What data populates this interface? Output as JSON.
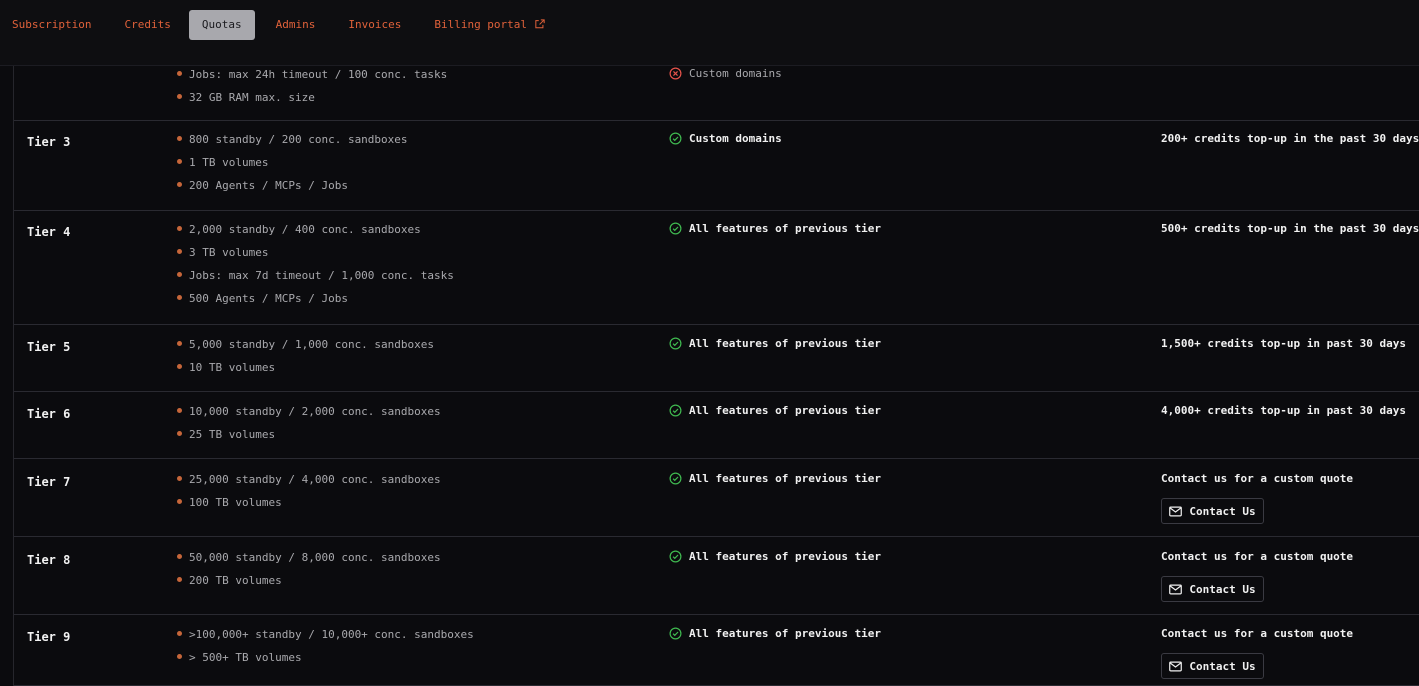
{
  "tabs": [
    {
      "label": "Subscription"
    },
    {
      "label": "Credits"
    },
    {
      "label": "Quotas"
    },
    {
      "label": "Admins"
    },
    {
      "label": "Invoices"
    },
    {
      "label": "Billing portal"
    }
  ],
  "colors": {
    "accent": "#e0613a",
    "success": "#3fb950",
    "error": "#e5534b"
  },
  "partial_row": {
    "limits": [
      "Jobs: max 24h timeout / 100 conc. tasks",
      "32 GB RAM max. size"
    ],
    "feature": "Custom domains",
    "feature_icon": "x-circle-icon"
  },
  "tiers": [
    {
      "name": "Tier 3",
      "limits": [
        "800 standby / 200 conc. sandboxes",
        "1 TB volumes",
        "200 Agents / MCPs / Jobs"
      ],
      "feature": "Custom domains",
      "requirement": "200+ credits top-up in the past 30 days"
    },
    {
      "name": "Tier 4",
      "limits": [
        "2,000 standby / 400 conc. sandboxes",
        "3 TB volumes",
        "Jobs: max 7d timeout / 1,000 conc. tasks",
        "500 Agents / MCPs / Jobs"
      ],
      "feature": "All features of previous tier",
      "requirement": "500+ credits top-up in the past 30 days"
    },
    {
      "name": "Tier 5",
      "limits": [
        "5,000 standby / 1,000 conc. sandboxes",
        "10 TB volumes"
      ],
      "feature": "All features of previous tier",
      "requirement": "1,500+ credits top-up in past 30 days"
    },
    {
      "name": "Tier 6",
      "limits": [
        "10,000 standby / 2,000 conc. sandboxes",
        "25 TB volumes"
      ],
      "feature": "All features of previous tier",
      "requirement": "4,000+ credits top-up in past 30 days"
    },
    {
      "name": "Tier 7",
      "limits": [
        "25,000 standby / 4,000 conc. sandboxes",
        "100 TB volumes"
      ],
      "feature": "All features of previous tier",
      "requirement": "Contact us for a custom quote",
      "button": "Contact Us"
    },
    {
      "name": "Tier 8",
      "limits": [
        "50,000 standby / 8,000 conc. sandboxes",
        "200 TB volumes"
      ],
      "feature": "All features of previous tier",
      "requirement": "Contact us for a custom quote",
      "button": "Contact Us"
    },
    {
      "name": "Tier 9",
      "limits": [
        ">100,000+ standby / 10,000+ conc. sandboxes",
        "> 500+ TB volumes"
      ],
      "feature": "All features of previous tier",
      "requirement": "Contact us for a custom quote",
      "button": "Contact Us"
    }
  ]
}
